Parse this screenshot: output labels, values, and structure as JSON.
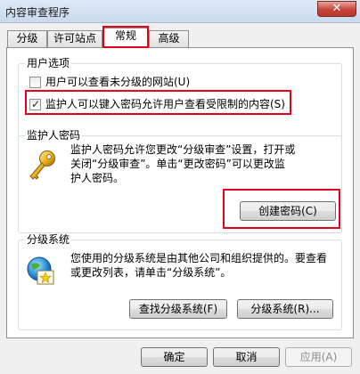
{
  "window": {
    "title": "内容审查程序",
    "close_symbol": "✕"
  },
  "tabs": [
    {
      "label": "分级"
    },
    {
      "label": "许可站点"
    },
    {
      "label": "常规"
    },
    {
      "label": "高级"
    }
  ],
  "user_options": {
    "title": "用户选项",
    "option1": {
      "label": "用户可以查看未分级的网站(U)",
      "checked": false
    },
    "option2": {
      "label": "监护人可以键入密码允许用户查看受限制的内容(S)",
      "checked": true,
      "check_mark": "✓"
    }
  },
  "supervisor": {
    "title": "监护人密码",
    "line1": "监护人密码允许您更改“分级审查”设置，打开或",
    "line2": "关闭“分级审查”。单击“更改密码”可以更改监",
    "line3": "护人密码。",
    "create_button": "创建密码(C)"
  },
  "rating_systems": {
    "title": "分级系统",
    "line1": "您使用的分级系统是由其他公司和组织提供的。要查看",
    "line2": "或更改列表，请单击“分级系统”。",
    "find_button": "查找分级系统(F)",
    "systems_button": "分级系统(R)..."
  },
  "footer": {
    "ok": "确定",
    "cancel": "取消",
    "apply": "应用(A)"
  }
}
